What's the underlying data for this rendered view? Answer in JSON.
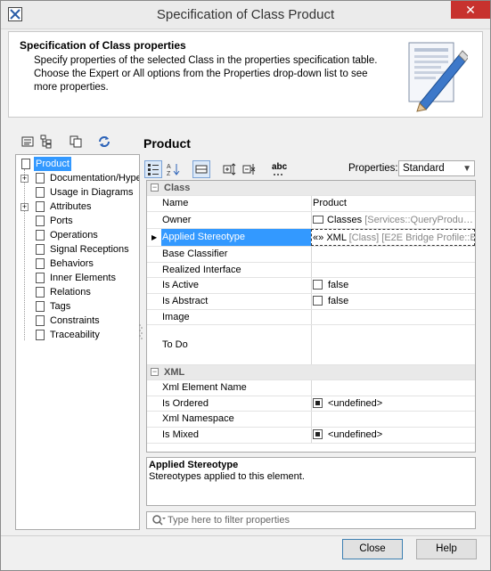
{
  "window": {
    "title": "Specification of Class Product",
    "close_symbol": "✕"
  },
  "header": {
    "title": "Specification of Class properties",
    "description": "Specify properties of the selected Class in the properties specification table. Choose the Expert or All options from the Properties drop-down list to see more properties."
  },
  "tree": {
    "items": [
      {
        "label": "Product",
        "expander": ""
      },
      {
        "label": "Documentation/Hype",
        "expander": "+"
      },
      {
        "label": "Usage in Diagrams",
        "expander": ""
      },
      {
        "label": "Attributes",
        "expander": "+"
      },
      {
        "label": "Ports",
        "expander": ""
      },
      {
        "label": "Operations",
        "expander": ""
      },
      {
        "label": "Signal Receptions",
        "expander": ""
      },
      {
        "label": "Behaviors",
        "expander": ""
      },
      {
        "label": "Inner Elements",
        "expander": ""
      },
      {
        "label": "Relations",
        "expander": ""
      },
      {
        "label": "Tags",
        "expander": ""
      },
      {
        "label": "Constraints",
        "expander": ""
      },
      {
        "label": "Traceability",
        "expander": ""
      }
    ]
  },
  "page_title": "Product",
  "properties_toolbar": {
    "label": "Properties:",
    "selected": "Standard",
    "abc_label": "abc"
  },
  "groups": {
    "class": {
      "label": "Class",
      "toggle": "−"
    },
    "xml": {
      "label": "XML",
      "toggle": "−"
    }
  },
  "rows": {
    "name": {
      "name": "Name",
      "value": "Product"
    },
    "owner": {
      "name": "Owner",
      "value": "Classes",
      "value_extra": "[Services::QueryProdu…"
    },
    "stereotype": {
      "name": "Applied Stereotype",
      "value_prefix": "«»",
      "value": "XML",
      "value_extra": "[Class] [E2E Bridge Profile::B"
    },
    "base_classifier": {
      "name": "Base Classifier",
      "value": ""
    },
    "realized_interface": {
      "name": "Realized Interface",
      "value": ""
    },
    "is_active": {
      "name": "Is Active",
      "value": "false"
    },
    "is_abstract": {
      "name": "Is Abstract",
      "value": "false"
    },
    "image": {
      "name": "Image",
      "value": ""
    },
    "to_do": {
      "name": "To Do",
      "value": ""
    },
    "xml_element_name": {
      "name": "Xml Element Name",
      "value": ""
    },
    "is_ordered": {
      "name": "Is Ordered",
      "value": "<undefined>"
    },
    "xml_namespace": {
      "name": "Xml Namespace",
      "value": ""
    },
    "is_mixed": {
      "name": "Is Mixed",
      "value": "<undefined>"
    }
  },
  "description": {
    "title": "Applied Stereotype",
    "text": "Stereotypes applied to this element."
  },
  "filter": {
    "placeholder": "Type here to filter properties"
  },
  "buttons": {
    "close": "Close",
    "help": "Help"
  }
}
